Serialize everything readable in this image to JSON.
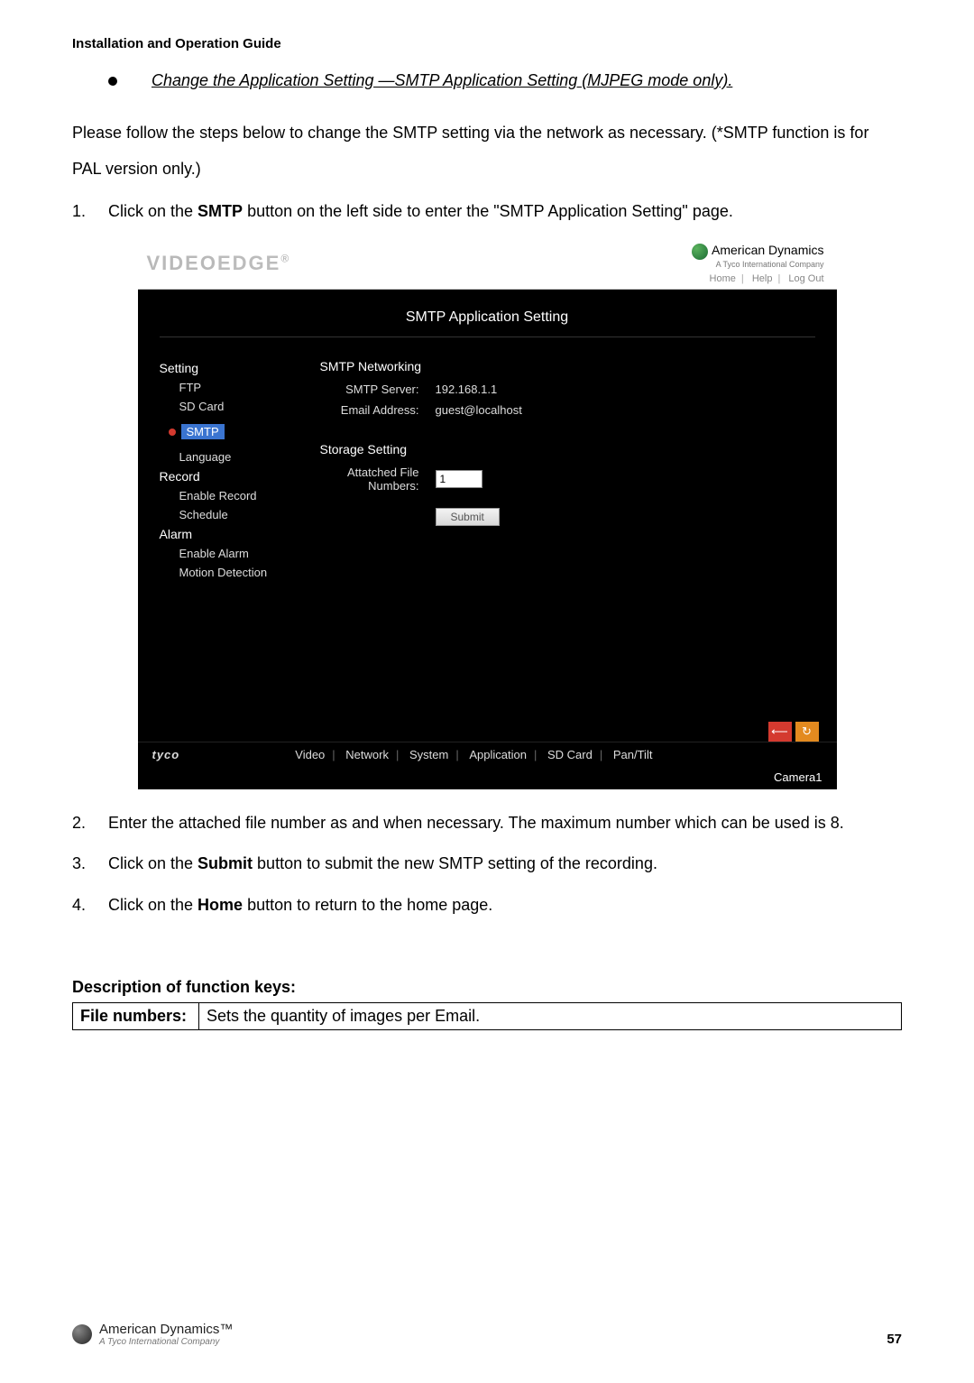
{
  "header_guide": "Installation and Operation Guide",
  "section_heading": "Change the Application Setting —SMTP Application Setting (MJPEG mode only).",
  "intro_para": "Please follow the steps below to change the SMTP setting via the network as necessary. (*SMTP function is for PAL version only.)",
  "steps": {
    "s1_pre": "Click on the ",
    "s1_bold": "SMTP",
    "s1_post": " button on the left side to enter the \"SMTP Application Setting\" page.",
    "s2": "Enter the attached file number as and when necessary. The maximum number which can be used is 8.",
    "s3_pre": "Click on the ",
    "s3_bold": "Submit",
    "s3_post": " button to submit the new SMTP setting of the recording.",
    "s4_pre": "Click on the ",
    "s4_bold": "Home",
    "s4_post": " button to return to the home page."
  },
  "app": {
    "logo_a": "VIDEO",
    "logo_b": "EDGE",
    "logo_r": "®",
    "brand": "American Dynamics",
    "brand_sub": "A Tyco International Company",
    "links": {
      "home": "Home",
      "help": "Help",
      "logout": "Log Out"
    },
    "page_title": "SMTP Application Setting",
    "sidebar": {
      "setting": "Setting",
      "ftp": "FTP",
      "sdcard": "SD Card",
      "smtp": "SMTP",
      "language": "Language",
      "record": "Record",
      "enable_record": "Enable Record",
      "schedule": "Schedule",
      "alarm": "Alarm",
      "enable_alarm": "Enable Alarm",
      "motion": "Motion Detection"
    },
    "content": {
      "net_head": "SMTP Networking",
      "server_label": "SMTP Server:",
      "server_val": "192.168.1.1",
      "email_label": "Email Address:",
      "email_val": "guest@localhost",
      "storage_head": "Storage Setting",
      "attach_label": "Attatched File Numbers:",
      "attach_val": "1",
      "submit": "Submit"
    },
    "footer": {
      "tyco": "tyco",
      "nav": [
        "Video",
        "Network",
        "System",
        "Application",
        "SD Card",
        "Pan/Tilt"
      ],
      "camera": "Camera1"
    }
  },
  "desc_heading": "Description of function keys:",
  "table": {
    "k1": "File numbers:",
    "v1": "Sets the quantity of images per Email."
  },
  "page_footer": {
    "brand": "American Dynamics™",
    "sub": "A Tyco International Company",
    "page_num": "57"
  }
}
